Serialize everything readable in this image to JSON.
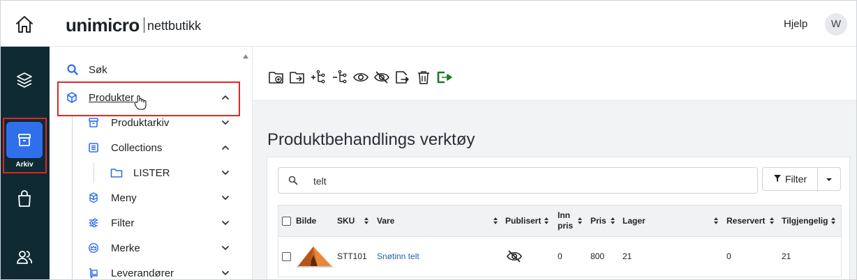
{
  "brand": {
    "name": "unimicro",
    "sub": "nettbutikk"
  },
  "header": {
    "help_label": "Hjelp",
    "avatar_initial": "W"
  },
  "rail": {
    "active_label": "Arkiv"
  },
  "nav": {
    "items": [
      {
        "label": "Søk"
      },
      {
        "label": "Produkter"
      },
      {
        "label": "Produktarkiv"
      },
      {
        "label": "Collections"
      },
      {
        "label": "LISTER"
      },
      {
        "label": "Meny"
      },
      {
        "label": "Filter"
      },
      {
        "label": "Merke"
      },
      {
        "label": "Leverandører"
      }
    ]
  },
  "page": {
    "title": "Produktbehandlings verktøy"
  },
  "search": {
    "value": "telt"
  },
  "filter": {
    "label": "Filter"
  },
  "table": {
    "headers": {
      "image": "Bilde",
      "sku": "SKU",
      "item": "Vare",
      "published": "Publisert",
      "cost_line1": "Inn",
      "cost_line2": "pris",
      "price": "Pris",
      "stock": "Lager",
      "reserved": "Reservert",
      "available": "Tilgjengelig"
    },
    "rows": [
      {
        "sku": "STT101",
        "item": "Snøtinn telt",
        "cost": "0",
        "price": "800",
        "stock": "21",
        "reserved": "0",
        "available": "21"
      }
    ]
  },
  "colors": {
    "rail_bg": "#0f2a33",
    "accent": "#2f6feb",
    "highlight": "#e02626",
    "link": "#2563a8",
    "exit_green": "#1f7a1f"
  }
}
